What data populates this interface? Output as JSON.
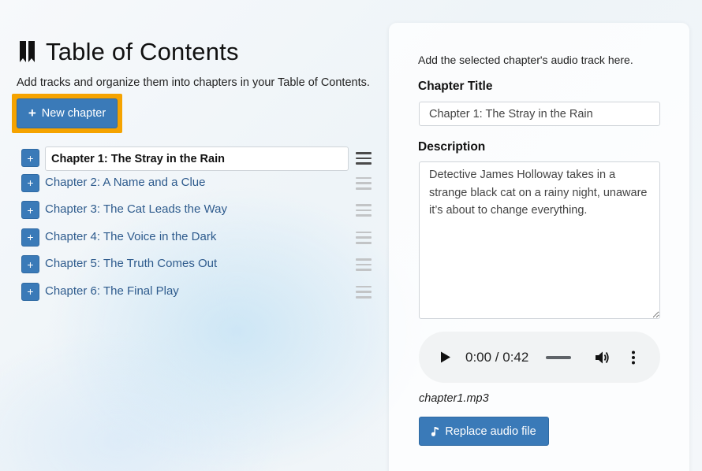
{
  "toc": {
    "title": "Table of Contents",
    "subtitle": "Add tracks and organize them into chapters in your Table of Contents.",
    "icon": "bookmark-icon",
    "new_chapter_label": "New chapter",
    "chapters": [
      {
        "title": "Chapter 1: The Stray in the Rain",
        "selected": true
      },
      {
        "title": "Chapter 2: A Name and a Clue",
        "selected": false
      },
      {
        "title": "Chapter 3: The Cat Leads the Way",
        "selected": false
      },
      {
        "title": "Chapter 4: The Voice in the Dark",
        "selected": false
      },
      {
        "title": "Chapter 5: The Truth Comes Out",
        "selected": false
      },
      {
        "title": "Chapter 6: The Final Play",
        "selected": false
      }
    ],
    "add_symbol": "+"
  },
  "panel": {
    "intro": "Add the selected chapter's audio track here.",
    "title_label": "Chapter Title",
    "title_value": "Chapter 1: The Stray in the Rain",
    "description_label": "Description",
    "description_value": "Detective James Holloway takes in a strange black cat on a rainy night, unaware it’s about to change everything.",
    "audio": {
      "time": "0:00 / 0:42"
    },
    "file_name": "chapter1.mp3",
    "replace_label": "Replace audio file"
  },
  "colors": {
    "accent": "#3a7ab8",
    "highlight": "#f5a300",
    "link": "#2e5b8d"
  }
}
